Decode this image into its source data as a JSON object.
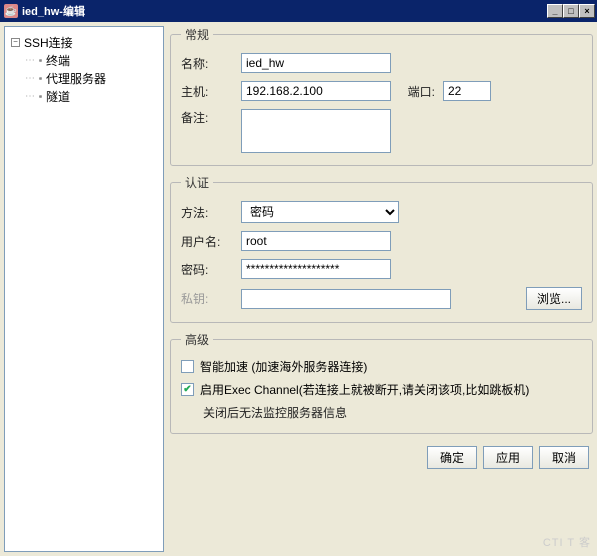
{
  "window": {
    "title": "ied_hw-编辑"
  },
  "sidebar": {
    "root": "SSH连接",
    "items": [
      "终端",
      "代理服务器",
      "隧道"
    ]
  },
  "group_general": {
    "legend": "常规",
    "name_label": "名称:",
    "name_value": "ied_hw",
    "host_label": "主机:",
    "host_value": "192.168.2.100",
    "port_label": "端口:",
    "port_value": "22",
    "remark_label": "备注:",
    "remark_value": ""
  },
  "group_auth": {
    "legend": "认证",
    "method_label": "方法:",
    "method_value": "密码",
    "user_label": "用户名:",
    "user_value": "root",
    "pwd_label": "密码:",
    "pwd_value": "********************",
    "key_label": "私钥:",
    "key_value": "",
    "browse_label": "浏览..."
  },
  "group_adv": {
    "legend": "高级",
    "smart_accel_label": "智能加速 (加速海外服务器连接)",
    "smart_accel_checked": false,
    "exec_channel_label": "启用Exec Channel(若连接上就被断开,请关闭该项,比如跳板机)",
    "exec_channel_checked": true,
    "note": "关闭后无法监控服务器信息"
  },
  "footer": {
    "ok": "确定",
    "apply": "应用",
    "cancel": "取消"
  },
  "watermark": "CTI T 客"
}
